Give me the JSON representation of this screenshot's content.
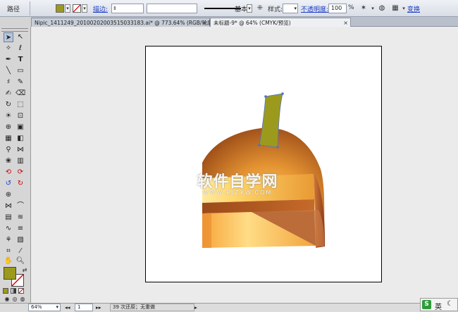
{
  "control_bar": {
    "path_label": "路径",
    "stroke_label": "描边:",
    "brush_label": "基本",
    "style_label": "样式:",
    "opacity_label": "不透明度:",
    "opacity_value": "100",
    "opacity_unit": "%",
    "transform_label": "变换",
    "fill_color": "#9c9a1c",
    "stroke_color": "#ffffff"
  },
  "tabs": [
    {
      "label": "Nipic_1411249_20100202003515033183.ai* @ 773.64% (RGB/轮廓)",
      "active": false
    },
    {
      "label": "未标题-9* @ 64% (CMYK/预览)",
      "active": true
    }
  ],
  "toolbar": {
    "fill_color": "#9c9a1c",
    "stroke_color": "#ffffff"
  },
  "watermark": {
    "main": "软件自学网",
    "sub": "WWW.RJZXW.COM"
  },
  "status_bar": {
    "zoom": "64%",
    "page": "1",
    "undo_text": "39 次还原；无重做",
    "ime_label": "英"
  }
}
